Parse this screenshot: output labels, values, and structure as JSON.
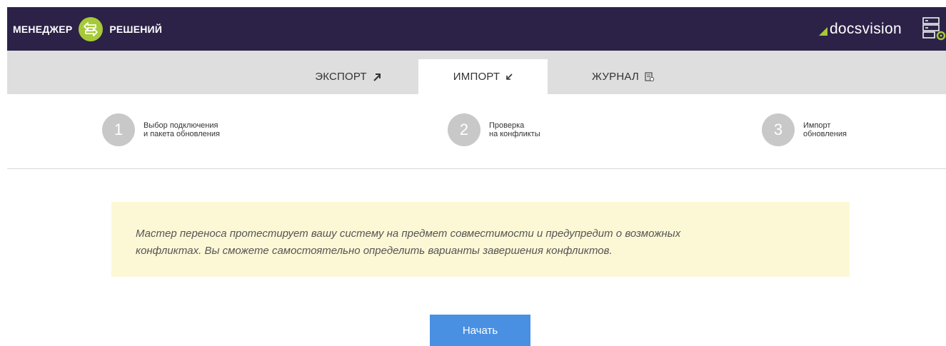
{
  "header": {
    "brand_left": "МЕНЕДЖЕР",
    "brand_right": "РЕШЕНИЙ",
    "brand_logo_icon": "swap-arrows-icon",
    "brand_logo_color": "#a6c93a",
    "product_name": "docsvision",
    "product_logo_color": "#a6c93a",
    "server_icon": "server-settings-icon",
    "background": "#2c2248"
  },
  "tabs": [
    {
      "label": "ЭКСПОРТ",
      "icon": "arrow-up-right-icon",
      "glyph": "↗",
      "active": false
    },
    {
      "label": "ИМПОРТ",
      "icon": "arrow-down-left-icon",
      "glyph": "↙",
      "active": true
    },
    {
      "label": "ЖУРНАЛ",
      "icon": "journal-icon",
      "active": false
    }
  ],
  "steps": [
    {
      "number": "1",
      "line1": "Выбор подключения",
      "line2": "и пакета обновления"
    },
    {
      "number": "2",
      "line1": "Проверка",
      "line2": "на конфликты"
    },
    {
      "number": "3",
      "line1": "Импорт",
      "line2": "обновления"
    }
  ],
  "info": {
    "line1": "Мастер переноса протестирует вашу систему на предмет совместимости и предупредит о возможных",
    "line2": "конфликтах. Вы сможете самостоятельно определить варианты завершения конфликтов.",
    "background": "#fcf8d6"
  },
  "start_button": {
    "label": "Начать",
    "color": "#4a90e2"
  }
}
